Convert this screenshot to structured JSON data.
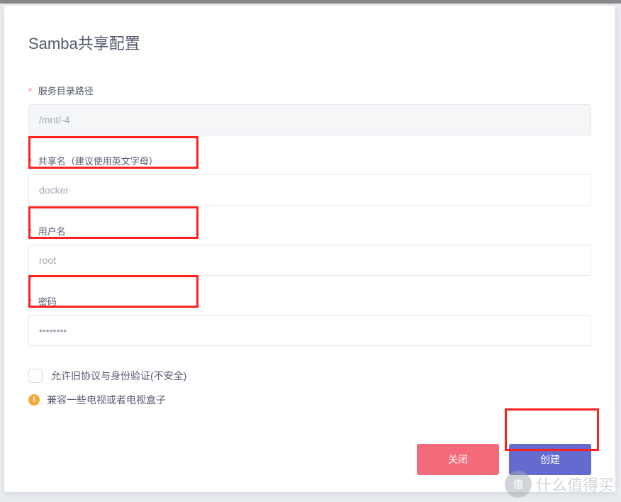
{
  "dialog": {
    "title": "Samba共享配置"
  },
  "form": {
    "path": {
      "label": "服务目录路径",
      "value": "/mnt/-4"
    },
    "sharename": {
      "label": "共享名（建议使用英文字母）",
      "value": "docker"
    },
    "username": {
      "label": "用户名",
      "value": "root"
    },
    "password": {
      "label": "密码",
      "value": "••••••••"
    },
    "allow_legacy": {
      "label": "允许旧协议与身份验证(不安全)"
    },
    "compat_info": {
      "text": "兼容一些电视或者电视盒子"
    }
  },
  "footer": {
    "close": "关闭",
    "create": "创建"
  },
  "watermark": {
    "icon": "值",
    "text": "什么值得买"
  }
}
